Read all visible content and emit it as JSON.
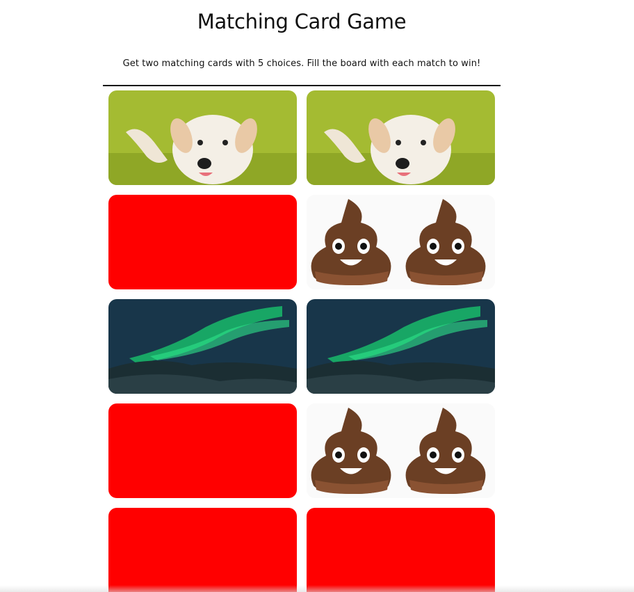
{
  "header": {
    "title": "Matching Card Game",
    "subtitle": "Get two matching cards with 5 choices. Fill the board with each match to win!"
  },
  "colors": {
    "card_back": "#ff0000",
    "divider": "#111111"
  },
  "cards": [
    {
      "state": "revealed",
      "image": "puppy-image"
    },
    {
      "state": "revealed",
      "image": "puppy-image"
    },
    {
      "state": "hidden",
      "color": "#ff0000"
    },
    {
      "state": "revealed",
      "image": "poop-emoji-image"
    },
    {
      "state": "revealed",
      "image": "aurora-image"
    },
    {
      "state": "revealed",
      "image": "aurora-image"
    },
    {
      "state": "hidden",
      "color": "#ff0000"
    },
    {
      "state": "revealed",
      "image": "poop-emoji-image"
    },
    {
      "state": "hidden",
      "color": "#ff0000"
    },
    {
      "state": "hidden",
      "color": "#ff0000"
    }
  ]
}
